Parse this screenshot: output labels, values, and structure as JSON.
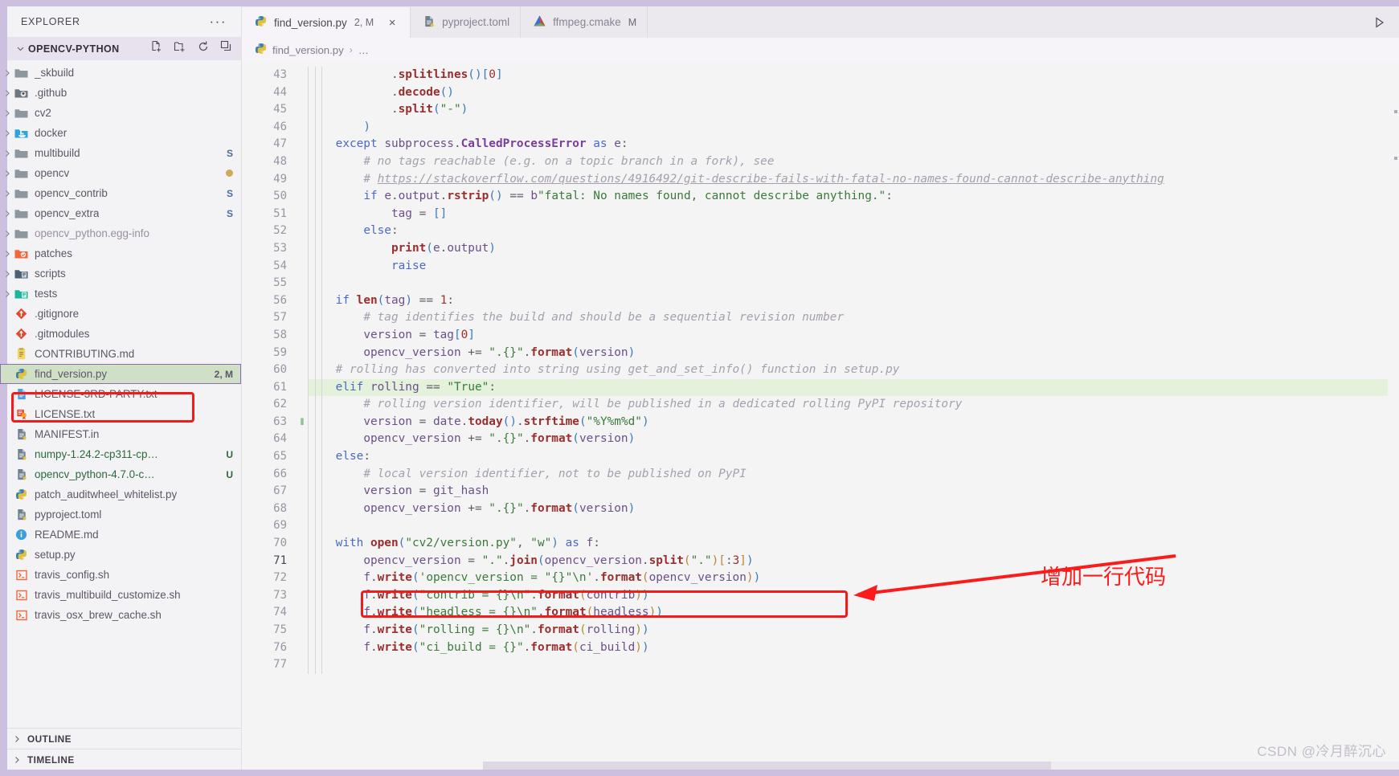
{
  "window": {
    "accent": "#cdbfe0"
  },
  "sidebar": {
    "title": "EXPLORER",
    "more_label": "···",
    "project": {
      "name": "OPENCV-PYTHON",
      "actions": [
        "new-file-icon",
        "new-folder-icon",
        "refresh-icon",
        "collapse-all-icon"
      ]
    },
    "tree": [
      {
        "label": "_skbuild",
        "type": "folder",
        "icon": "folder-icon",
        "expandable": true,
        "badge": ""
      },
      {
        "label": ".github",
        "type": "folder",
        "icon": "folder-github-icon",
        "expandable": true,
        "badge": ""
      },
      {
        "label": "cv2",
        "type": "folder",
        "icon": "folder-icon",
        "expandable": true,
        "badge": ""
      },
      {
        "label": "docker",
        "type": "folder",
        "icon": "folder-docker-icon",
        "expandable": true,
        "badge": ""
      },
      {
        "label": "multibuild",
        "type": "folder",
        "icon": "folder-icon",
        "expandable": true,
        "badge": "S"
      },
      {
        "label": "opencv",
        "type": "folder",
        "icon": "folder-icon",
        "expandable": true,
        "badge": "●"
      },
      {
        "label": "opencv_contrib",
        "type": "folder",
        "icon": "folder-icon",
        "expandable": true,
        "badge": "S"
      },
      {
        "label": "opencv_extra",
        "type": "folder",
        "icon": "folder-icon",
        "expandable": true,
        "badge": "S"
      },
      {
        "label": "opencv_python.egg-info",
        "type": "folder",
        "icon": "folder-icon",
        "expandable": true,
        "badge": "",
        "dim": true
      },
      {
        "label": "patches",
        "type": "folder",
        "icon": "folder-patch-icon",
        "expandable": true,
        "badge": ""
      },
      {
        "label": "scripts",
        "type": "folder",
        "icon": "folder-scripts-icon",
        "expandable": true,
        "badge": ""
      },
      {
        "label": "tests",
        "type": "folder",
        "icon": "folder-tests-icon",
        "expandable": true,
        "badge": ""
      },
      {
        "label": ".gitignore",
        "type": "file",
        "icon": "git-icon",
        "expandable": false,
        "badge": ""
      },
      {
        "label": ".gitmodules",
        "type": "file",
        "icon": "git-icon",
        "expandable": false,
        "badge": ""
      },
      {
        "label": "CONTRIBUTING.md",
        "type": "file",
        "icon": "markdown-icon",
        "expandable": false,
        "badge": ""
      },
      {
        "label": "find_version.py",
        "type": "file",
        "icon": "python-icon",
        "expandable": false,
        "badge": "2, M",
        "selected": true
      },
      {
        "label": "LICENSE-3RD-PARTY.txt",
        "type": "file",
        "icon": "text-icon",
        "expandable": false,
        "badge": ""
      },
      {
        "label": "LICENSE.txt",
        "type": "file",
        "icon": "certificate-icon",
        "expandable": false,
        "badge": ""
      },
      {
        "label": "MANIFEST.in",
        "type": "file",
        "icon": "document-icon",
        "expandable": false,
        "badge": ""
      },
      {
        "label": "numpy-1.24.2-cp311-cp…",
        "type": "file",
        "icon": "document-icon",
        "expandable": false,
        "badge": "U",
        "green": true
      },
      {
        "label": "opencv_python-4.7.0-c…",
        "type": "file",
        "icon": "document-icon",
        "expandable": false,
        "badge": "U",
        "green": true
      },
      {
        "label": "patch_auditwheel_whitelist.py",
        "type": "file",
        "icon": "python-icon",
        "expandable": false,
        "badge": ""
      },
      {
        "label": "pyproject.toml",
        "type": "file",
        "icon": "document-icon",
        "expandable": false,
        "badge": ""
      },
      {
        "label": "README.md",
        "type": "file",
        "icon": "info-icon",
        "expandable": false,
        "badge": ""
      },
      {
        "label": "setup.py",
        "type": "file",
        "icon": "python-icon",
        "expandable": false,
        "badge": ""
      },
      {
        "label": "travis_config.sh",
        "type": "file",
        "icon": "shell-icon",
        "expandable": false,
        "badge": ""
      },
      {
        "label": "travis_multibuild_customize.sh",
        "type": "file",
        "icon": "shell-icon",
        "expandable": false,
        "badge": ""
      },
      {
        "label": "travis_osx_brew_cache.sh",
        "type": "file",
        "icon": "shell-icon",
        "expandable": false,
        "badge": ""
      }
    ],
    "panels": [
      {
        "label": "OUTLINE"
      },
      {
        "label": "TIMELINE"
      }
    ]
  },
  "tabs": [
    {
      "label": "find_version.py",
      "status": "2, M",
      "icon": "python-icon",
      "active": true,
      "close": "×"
    },
    {
      "label": "pyproject.toml",
      "status": "",
      "icon": "document-icon",
      "active": false,
      "close": ""
    },
    {
      "label": "ffmpeg.cmake",
      "status": "M",
      "icon": "cmake-icon",
      "active": false,
      "close": ""
    }
  ],
  "tabbar_right_icon": "open-preview-icon",
  "breadcrumb": {
    "file": "find_version.py",
    "separator": "›",
    "trail": "…",
    "icon": "python-icon"
  },
  "editor": {
    "first_line": 43,
    "last_line": 77,
    "current_line": 71,
    "highlighted_line": 61,
    "lines": [
      {
        "n": 43,
        "text": "            .splitlines()[0]"
      },
      {
        "n": 44,
        "text": "            .decode()"
      },
      {
        "n": 45,
        "text": "            .split(\"-\")"
      },
      {
        "n": 46,
        "text": "        )"
      },
      {
        "n": 47,
        "text": "    except subprocess.CalledProcessError as e:"
      },
      {
        "n": 48,
        "text": "        # no tags reachable (e.g. on a topic branch in a fork), see"
      },
      {
        "n": 49,
        "text": "        # https://stackoverflow.com/questions/4916492/git-describe-fails-with-fatal-no-names-found-cannot-describe-anything"
      },
      {
        "n": 50,
        "text": "        if e.output.rstrip() == b\"fatal: No names found, cannot describe anything.\":"
      },
      {
        "n": 51,
        "text": "            tag = []"
      },
      {
        "n": 52,
        "text": "        else:"
      },
      {
        "n": 53,
        "text": "            print(e.output)"
      },
      {
        "n": 54,
        "text": "            raise"
      },
      {
        "n": 55,
        "text": ""
      },
      {
        "n": 56,
        "text": "    if len(tag) == 1:"
      },
      {
        "n": 57,
        "text": "        # tag identifies the build and should be a sequential revision number"
      },
      {
        "n": 58,
        "text": "        version = tag[0]"
      },
      {
        "n": 59,
        "text": "        opencv_version += \".{}\".format(version)"
      },
      {
        "n": 60,
        "text": "    # rolling has converted into string using get_and_set_info() function in setup.py"
      },
      {
        "n": 61,
        "text": "    elif rolling == \"True\":"
      },
      {
        "n": 62,
        "text": "        # rolling version identifier, will be published in a dedicated rolling PyPI repository"
      },
      {
        "n": 63,
        "text": "        version = date.today().strftime(\"%Y%m%d\")"
      },
      {
        "n": 64,
        "text": "        opencv_version += \".{}\".format(version)"
      },
      {
        "n": 65,
        "text": "    else:"
      },
      {
        "n": 66,
        "text": "        # local version identifier, not to be published on PyPI"
      },
      {
        "n": 67,
        "text": "        version = git_hash"
      },
      {
        "n": 68,
        "text": "        opencv_version += \".{}\".format(version)"
      },
      {
        "n": 69,
        "text": ""
      },
      {
        "n": 70,
        "text": "    with open(\"cv2/version.py\", \"w\") as f:"
      },
      {
        "n": 71,
        "text": "        opencv_version = \".\".join(opencv_version.split(\".\")[:3])"
      },
      {
        "n": 72,
        "text": "        f.write('opencv_version = \"{}\"\\n'.format(opencv_version))"
      },
      {
        "n": 73,
        "text": "        f.write(\"contrib = {}\\n\".format(contrib))"
      },
      {
        "n": 74,
        "text": "        f.write(\"headless = {}\\n\".format(headless))"
      },
      {
        "n": 75,
        "text": "        f.write(\"rolling = {}\\n\".format(rolling))"
      },
      {
        "n": 76,
        "text": "        f.write(\"ci_build = {}\".format(ci_build))"
      },
      {
        "n": 77,
        "text": ""
      }
    ]
  },
  "annotations": {
    "callout_text": "增加一行代码",
    "color": "#fb1b1b",
    "boxes": [
      "sidebar-file-highlight",
      "code-line-71-highlight"
    ],
    "arrow": "arrow-to-line-71"
  },
  "watermark": "CSDN @冷月醉沉心"
}
